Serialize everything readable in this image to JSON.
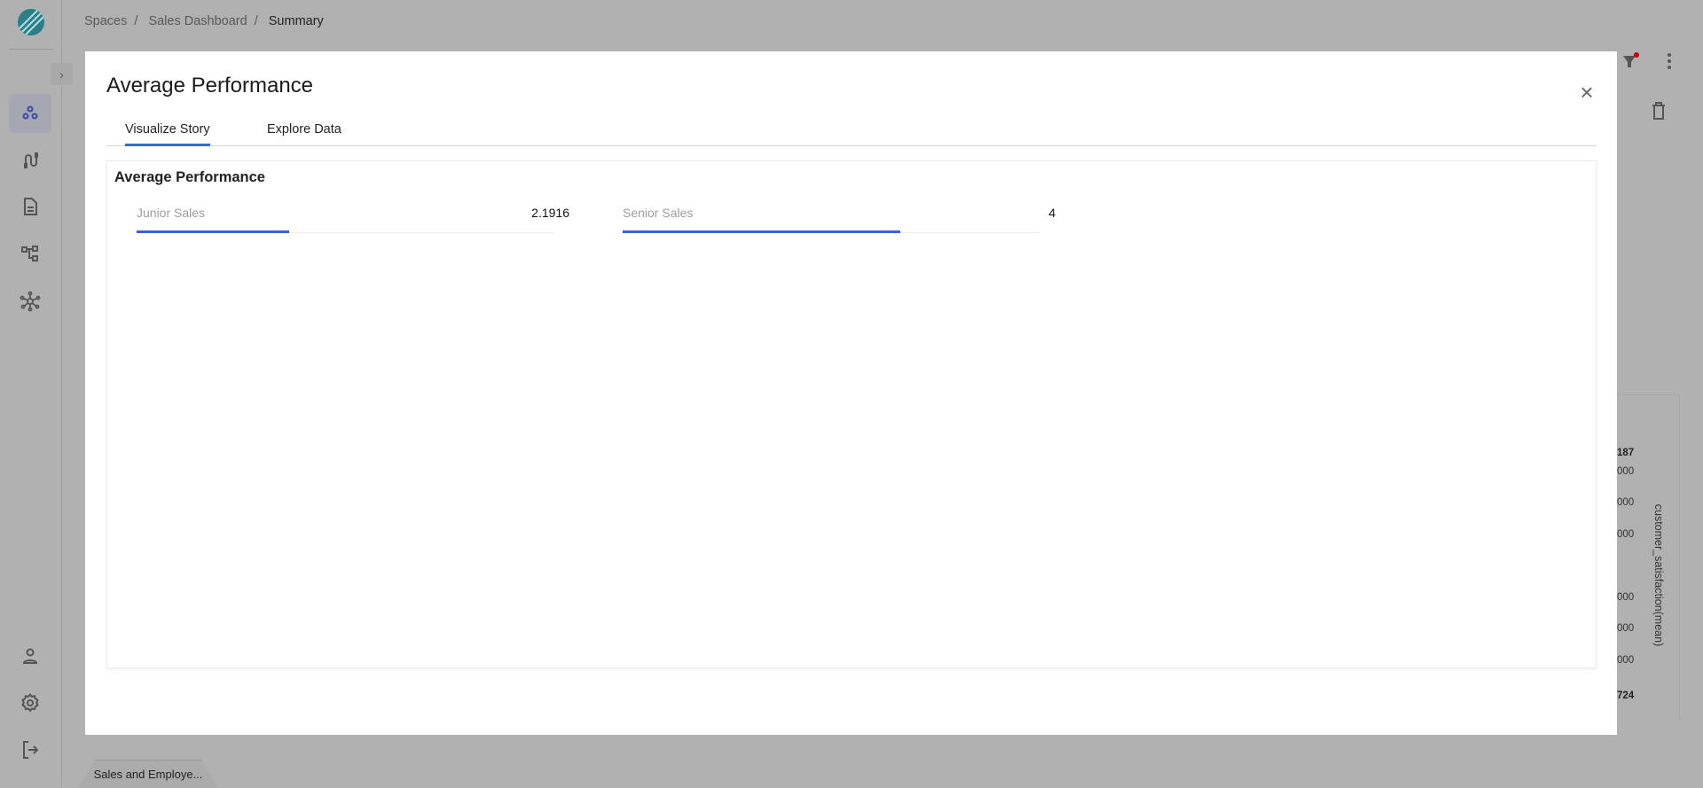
{
  "breadcrumb": [
    "Spaces",
    "Sales Dashboard",
    "Summary"
  ],
  "sidebar": {
    "items": [
      {
        "icon": "circles-icon",
        "active": true
      },
      {
        "icon": "connector-icon"
      },
      {
        "icon": "document-icon"
      },
      {
        "icon": "hierarchy-icon"
      },
      {
        "icon": "network-icon"
      }
    ],
    "bottom_items": [
      {
        "icon": "user-icon"
      },
      {
        "icon": "gear-icon"
      },
      {
        "icon": "logout-icon"
      }
    ]
  },
  "background": {
    "axis_values": [
      "187",
      "000",
      "000",
      "000",
      "000",
      "000",
      "000",
      "724"
    ],
    "axis_label": "customer_satisfaction(mean)",
    "bottom_tab": "Sales and Employe..."
  },
  "modal": {
    "title": "Average Performance",
    "tabs": [
      {
        "label": "Visualize Story",
        "active": true
      },
      {
        "label": "Explore Data"
      }
    ],
    "card": {
      "title": "Average Performance",
      "items": [
        {
          "label": "Junior Sales",
          "value": "2.1916",
          "fill_percent": 36.5
        },
        {
          "label": "Senior Sales",
          "value": "4",
          "fill_percent": 66.7
        }
      ]
    }
  },
  "colors": {
    "accent": "#3d5fd7",
    "tab_underline": "#2f6fcf",
    "filter_dot": "#cc0000"
  }
}
